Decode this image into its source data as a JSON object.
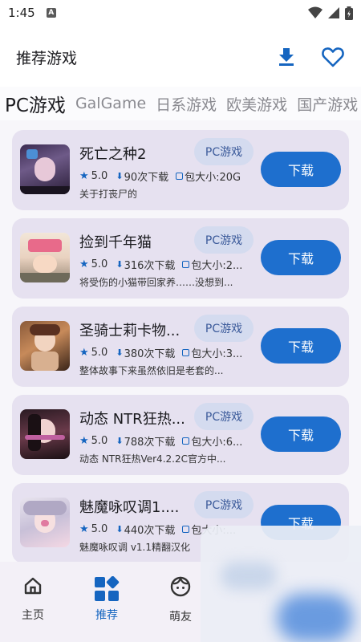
{
  "status_bar": {
    "time": "1:45",
    "indicator": "A"
  },
  "app_bar": {
    "title": "推荐游戏",
    "download_icon": "download-icon",
    "favorite_icon": "heart-icon"
  },
  "tabs": [
    {
      "label": "PC游戏",
      "active": true
    },
    {
      "label": "GalGame",
      "active": false
    },
    {
      "label": "日系游戏",
      "active": false
    },
    {
      "label": "欧美游戏",
      "active": false
    },
    {
      "label": "国产游戏",
      "active": false
    }
  ],
  "games": [
    {
      "name": "死亡之种2",
      "tag": "PC游戏",
      "rating": "5.0",
      "downloads": "90次下载",
      "size": "包大小:20G",
      "description": "关于打丧尸的",
      "button": "下载"
    },
    {
      "name": "捡到千年猫",
      "tag": "PC游戏",
      "rating": "5.0",
      "downloads": "316次下载",
      "size": "包大小:2...",
      "description": "将受伤的小猫带回家养……没想到...",
      "button": "下载"
    },
    {
      "name": "圣骑士莉卡物...",
      "tag": "PC游戏",
      "rating": "5.0",
      "downloads": "380次下载",
      "size": "包大小:3...",
      "description": "整体故事下来虽然依旧是老套的...",
      "button": "下载"
    },
    {
      "name": "动态 NTR狂热...",
      "tag": "PC游戏",
      "rating": "5.0",
      "downloads": "788次下载",
      "size": "包大小:6...",
      "description": "动态 NTR狂热Ver4.2.2C官方中...",
      "button": "下载"
    },
    {
      "name": "魅魔咏叹调1....",
      "tag": "PC游戏",
      "rating": "5.0",
      "downloads": "440次下载",
      "size": "包大小:...",
      "description": "魅魔咏叹调 v1.1精翻汉化",
      "button": "下载"
    }
  ],
  "bottom_nav": [
    {
      "label": "主页",
      "icon": "home-icon",
      "active": false
    },
    {
      "label": "推荐",
      "icon": "grid-icon",
      "active": true
    },
    {
      "label": "萌友",
      "icon": "face-icon",
      "active": false
    }
  ],
  "colors": {
    "accent": "#1e6fce",
    "card_bg": "#e6e1f0",
    "chip_bg": "#d4dbef",
    "nav_bg": "#f3f0f7"
  }
}
